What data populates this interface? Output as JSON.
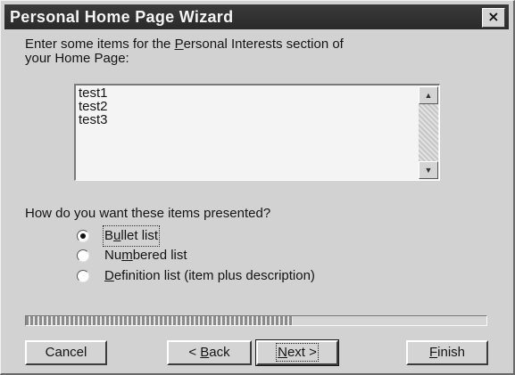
{
  "window": {
    "title": "Personal Home Page Wizard",
    "close_glyph": "×"
  },
  "prompt": {
    "line1_before": "Enter some items for the ",
    "line1_accel": "P",
    "line1_after": "ersonal Interests section of",
    "line2": "your Home Page:"
  },
  "listbox": {
    "items": [
      "test1",
      "test2",
      "test3"
    ],
    "scroll_up_glyph": "▲",
    "scroll_down_glyph": "▼"
  },
  "presentation": {
    "question": "How do you want these items presented?",
    "selected": "bullet",
    "options": [
      {
        "id": "bullet",
        "before": "B",
        "accel": "u",
        "after": "llet list"
      },
      {
        "id": "numbered",
        "before": "Nu",
        "accel": "m",
        "after": "bered list"
      },
      {
        "id": "definition",
        "before": "",
        "accel": "D",
        "after": "efinition list (item plus description)"
      }
    ]
  },
  "progress": {
    "fraction": 0.58
  },
  "buttons": {
    "cancel": {
      "before": "Cancel",
      "accel": "",
      "after": ""
    },
    "back": {
      "before": "< ",
      "accel": "B",
      "after": "ack"
    },
    "next": {
      "before": "",
      "accel": "N",
      "after": "ext >"
    },
    "finish": {
      "before": "",
      "accel": "F",
      "after": "inish"
    }
  }
}
